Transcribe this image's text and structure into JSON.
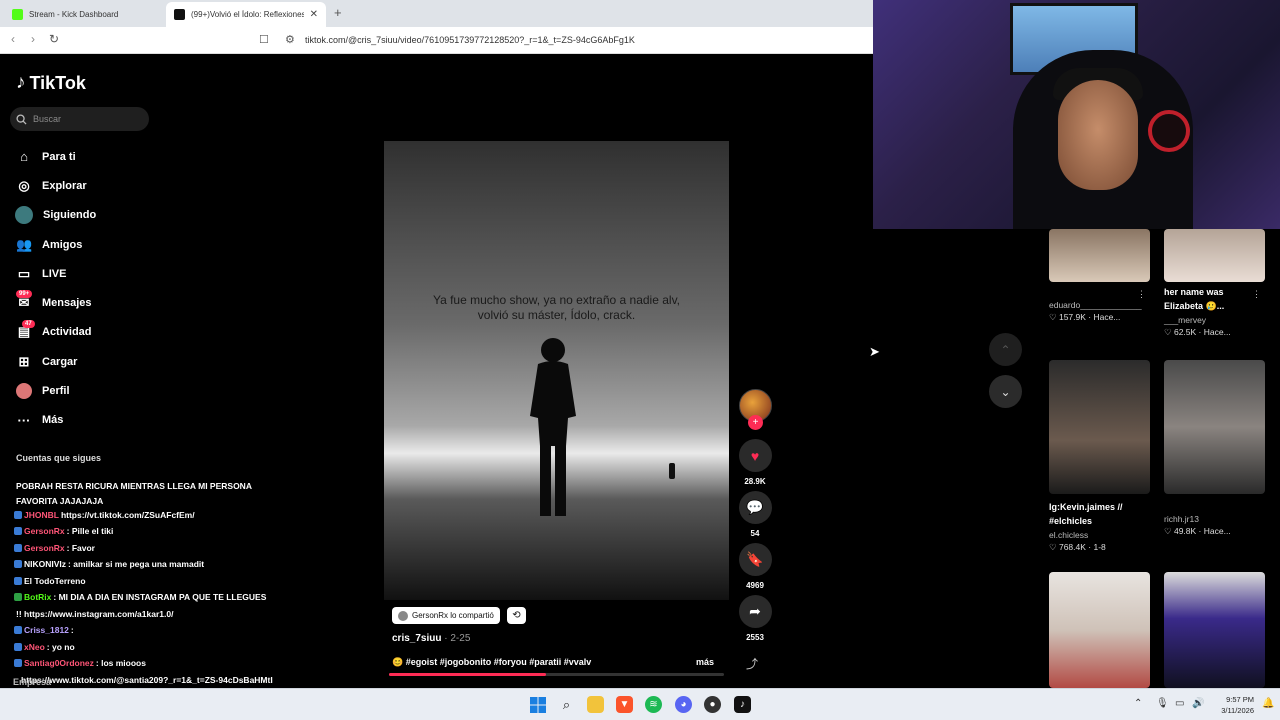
{
  "browser": {
    "tabs": [
      {
        "title": "Stream - Kick Dashboard",
        "favicon_color": "#53fc18"
      },
      {
        "title": "(99+)Volvió el Ídolo: Reflexiones",
        "favicon_color": "#111111"
      }
    ],
    "url": "tiktok.com/@cris_7siuu/video/7610951739772128520?_r=1&_t=ZS-94cG6AbFg1K"
  },
  "sidebar": {
    "logo": "TikTok",
    "search_placeholder": "Buscar",
    "items": [
      {
        "label": "Para ti",
        "icon": "home-icon"
      },
      {
        "label": "Explorar",
        "icon": "compass-icon"
      },
      {
        "label": "Siguiendo",
        "icon": "following-icon"
      },
      {
        "label": "Amigos",
        "icon": "friends-icon"
      },
      {
        "label": "LIVE",
        "icon": "live-icon"
      },
      {
        "label": "Mensajes",
        "icon": "message-icon",
        "badge": "99+"
      },
      {
        "label": "Actividad",
        "icon": "activity-icon",
        "badge": "47"
      },
      {
        "label": "Cargar",
        "icon": "upload-icon"
      },
      {
        "label": "Perfil",
        "icon": "profile-icon"
      },
      {
        "label": "Más",
        "icon": "more-icon"
      }
    ],
    "following_heading": "Cuentas que sigues",
    "footer": "Empresa"
  },
  "chat": {
    "lines": [
      {
        "user": "",
        "user_color": "#ffffff",
        "text": "POBRAH RESTA RICURA MIENTRAS LLEGA MI PERSONA"
      },
      {
        "user": "",
        "user_color": "#ffffff",
        "text": "FAVORITA JAJAJAJA"
      },
      {
        "user": "JHONBL",
        "user_color": "#ff5577",
        "text": "https://vt.tiktok.com/ZSuAFcfEm/"
      },
      {
        "user": "GersonRx",
        "user_color": "#ff5577",
        "text": ": Pille el tiki"
      },
      {
        "user": "GersonRx",
        "user_color": "#ff5577",
        "text": ": Favor"
      },
      {
        "user": "NIKONIVIz",
        "user_color": "#ffffff",
        "text": ": amilkar si me pega una mamadit"
      },
      {
        "user": "El TodoTerreno",
        "user_color": "#ffffff",
        "text": ""
      },
      {
        "user": "BotRix",
        "user_color": "#53fc18",
        "text": ": MI DIA A DIA EN INSTAGRAM PA QUE TE LLEGUES"
      },
      {
        "user": "",
        "user_color": "#ffffff",
        "text": "!! https://www.instagram.com/a1kar1.0/"
      },
      {
        "user": "Criss_1812",
        "user_color": "#b9a3ff",
        "text": ":"
      },
      {
        "user": "xNeo",
        "user_color": "#ff5577",
        "text": ": yo no"
      },
      {
        "user": "Santiag0Ordonez",
        "user_color": "#ff5577",
        "text": ": los miooos"
      },
      {
        "user": "",
        "user_color": "#ffffff",
        "text": "https://www.tiktok.com/@santia209?_r=1&_t=ZS-94cDsBaHMtI"
      }
    ]
  },
  "video": {
    "overlay_text": "Ya fue mucho show, ya no extraño a nadie alv, volvió su máster, Ídolo, crack.",
    "shared_by": "GersonRx lo compartió",
    "author": "cris_7siuu",
    "date": "· 2-25",
    "description": "#egoist #jogobonito #foryou #paratii #vvalv",
    "more": "más",
    "progress": 0.47
  },
  "actions": {
    "likes": "28.9K",
    "comments": "54",
    "saves": "4969",
    "shares": "2553"
  },
  "recommended": [
    {
      "title": "",
      "author": "eduardo_____________",
      "stats": "♡ 157.9K · Hace..."
    },
    {
      "title": "her name was Elizabeta 🥲...",
      "author": "___mervey",
      "stats": "♡ 62.5K · Hace..."
    },
    {
      "title": "Ig:Kevin.jaimes // #elchicles",
      "author": "el.chicless",
      "stats": "♡ 768.4K · 1-8"
    },
    {
      "title": "",
      "author": "richh.jr13",
      "stats": "♡ 49.8K · Hace..."
    },
    {
      "title": "",
      "author": "",
      "stats": ""
    },
    {
      "title": "",
      "author": "",
      "stats": ""
    }
  ],
  "taskbar": {
    "time": "9:57 PM",
    "date": "3/11/2026"
  }
}
